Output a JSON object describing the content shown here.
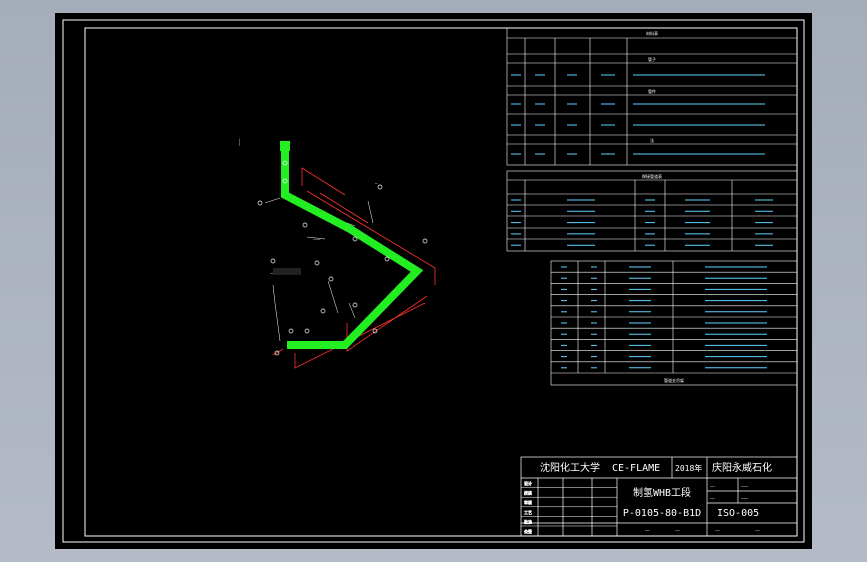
{
  "drawing": {
    "school": "沈阳化工大学",
    "program": "CE-FLAME",
    "year": "2018年",
    "company": "庆阳永威石化",
    "drawing_name": "制氢WHB工段",
    "line_number": "P-0105-80-B1D",
    "drawing_number": "ISO-005",
    "sign_rows": [
      "设计",
      "校核",
      "审核",
      "工艺",
      "批准",
      "会签"
    ]
  },
  "tables": {
    "material_title": "材料表",
    "section_pipe": "管子",
    "section_fitting": "管件",
    "section_flange": "法",
    "weld_title": "焊接管道表",
    "weld_rows": 5,
    "support_rows": 10,
    "support_footer": "管道支吊架"
  },
  "colors": {
    "sheet": "#000000",
    "frame": "#ffffff",
    "pipe": "#22ee22",
    "dimension": "#ff3030",
    "table_text": "#5fd3ff"
  }
}
